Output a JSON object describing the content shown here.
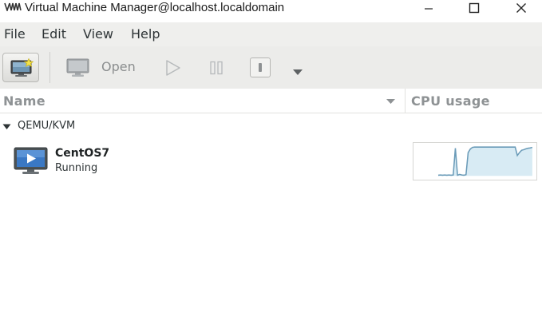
{
  "window": {
    "title": "Virtual Machine Manager@localhost.localdomain"
  },
  "menubar": {
    "items": [
      {
        "label": "File"
      },
      {
        "label": "Edit"
      },
      {
        "label": "View"
      },
      {
        "label": "Help"
      }
    ]
  },
  "toolbar": {
    "new_vm_icon": "monitor-star-icon",
    "open_label": "Open",
    "open_icon": "monitor-icon",
    "run_icon": "play-icon",
    "pause_icon": "pause-icon",
    "shutdown_icon": "power-plug-icon",
    "dropdown_icon": "chevron-down-icon"
  },
  "columns": {
    "name": "Name",
    "cpu_usage": "CPU usage"
  },
  "connections": [
    {
      "label": "QEMU/KVM",
      "expanded": true,
      "vms": [
        {
          "name": "CentOS7",
          "status": "Running",
          "icon": "vm-running-icon",
          "cpu_history": [
            2,
            3,
            2,
            3,
            2,
            3,
            2,
            3,
            95,
            2,
            5,
            3,
            2,
            4,
            80,
            92,
            98,
            99,
            99,
            99,
            99,
            99,
            99,
            99,
            99,
            99,
            99,
            99,
            99,
            99,
            99,
            99,
            99,
            99,
            99,
            99,
            99,
            70,
            80,
            88,
            90,
            93,
            95,
            96,
            98
          ]
        }
      ]
    }
  ],
  "colors": {
    "menubar_bg": "#efefed",
    "toolbar_bg": "#ececea",
    "graph_line": "#6a9bb8",
    "graph_fill": "#d8ebf4",
    "vm_icon_blue": "#3a78c4"
  }
}
